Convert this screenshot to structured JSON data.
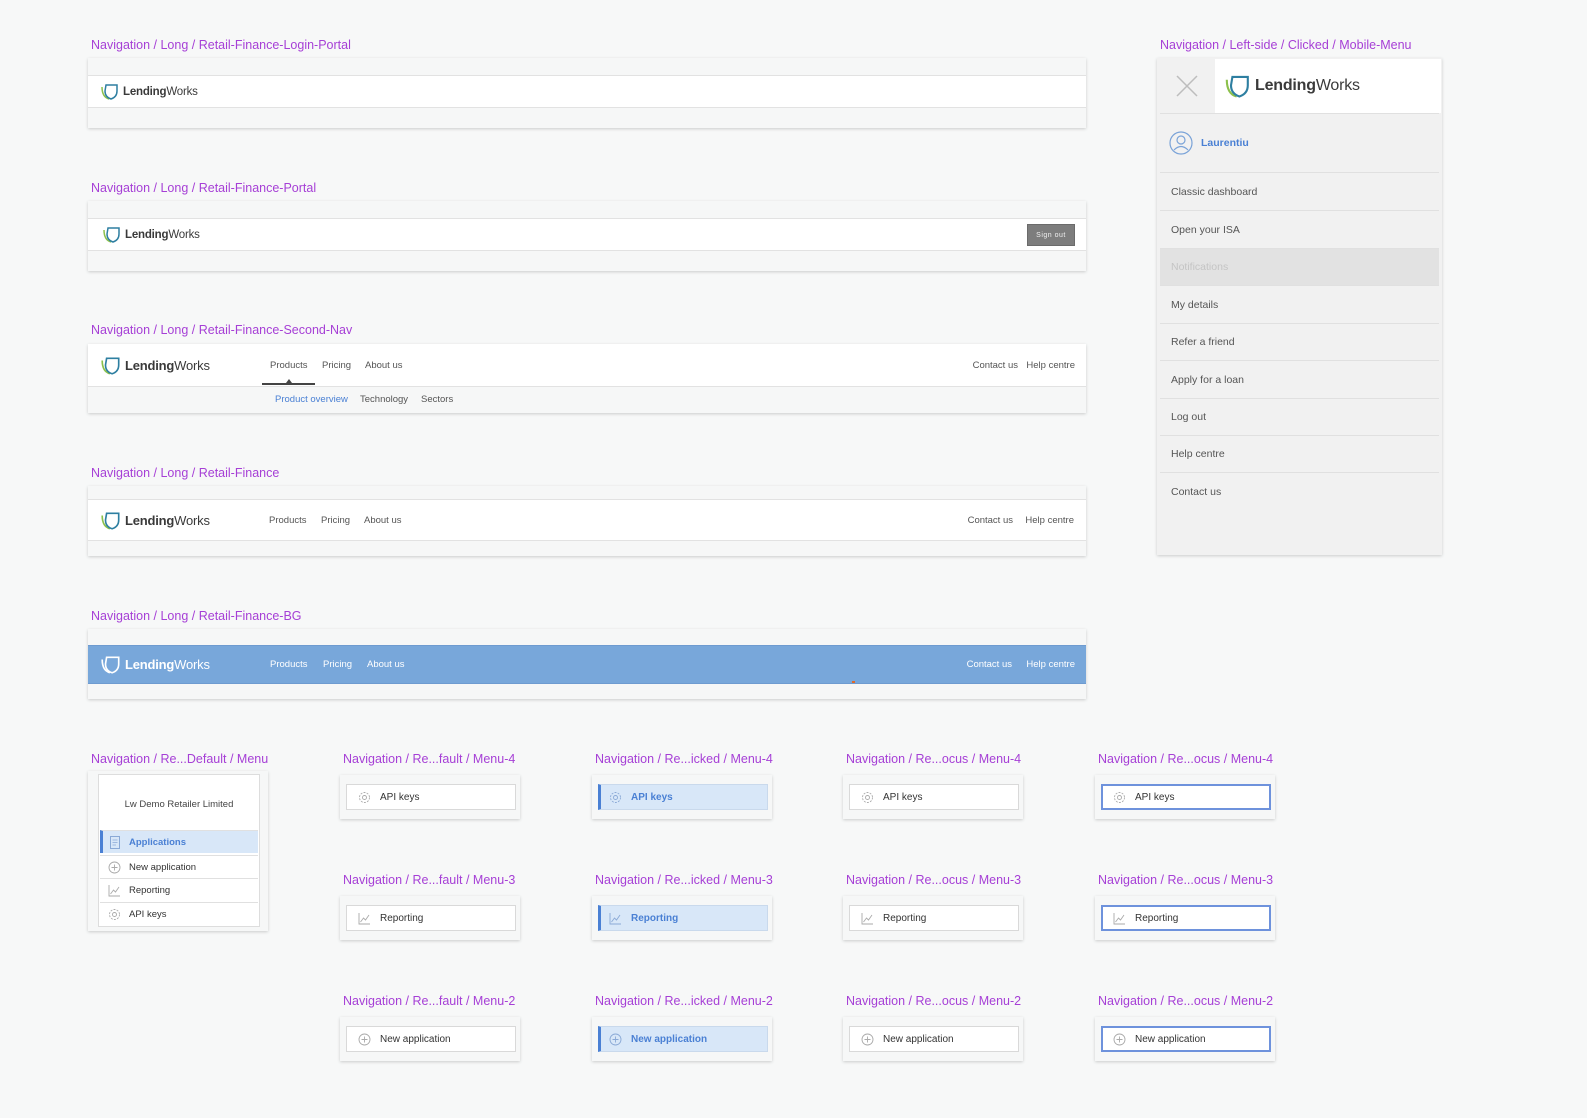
{
  "brand": {
    "logo_bold": "Lending",
    "logo_light": "Works"
  },
  "labels": {
    "login_portal": "Navigation / Long / Retail-Finance-Login-Portal",
    "portal": "Navigation / Long / Retail-Finance-Portal",
    "second_nav": "Navigation / Long / Retail-Finance-Second-Nav",
    "retail_finance": "Navigation / Long / Retail-Finance",
    "retail_finance_bg": "Navigation / Long / Retail-Finance-BG",
    "mobile_menu": "Navigation / Left-side / Clicked / Mobile-Menu",
    "default_menu": "Navigation / Re...Default / Menu",
    "default_menu4": "Navigation / Re...fault / Menu-4",
    "clicked_menu4": "Navigation / Re...icked / Menu-4",
    "focus_menu4_a": "Navigation / Re...ocus / Menu-4",
    "focus_menu4_b": "Navigation / Re...ocus / Menu-4",
    "default_menu3": "Navigation / Re...fault / Menu-3",
    "clicked_menu3": "Navigation / Re...icked / Menu-3",
    "focus_menu3_a": "Navigation / Re...ocus / Menu-3",
    "focus_menu3_b": "Navigation / Re...ocus / Menu-3",
    "default_menu2": "Navigation / Re...fault / Menu-2",
    "clicked_menu2": "Navigation / Re...icked / Menu-2",
    "focus_menu2_a": "Navigation / Re...ocus / Menu-2",
    "focus_menu2_b": "Navigation / Re...ocus / Menu-2"
  },
  "portal": {
    "sign_out": "Sign out"
  },
  "nav": {
    "products": "Products",
    "pricing": "Pricing",
    "about": "About us",
    "contact": "Contact us",
    "help": "Help centre"
  },
  "sub_nav": {
    "overview": "Product overview",
    "technology": "Technology",
    "sectors": "Sectors"
  },
  "mobile_menu": {
    "user": "Laurentiu",
    "items": [
      "Classic dashboard",
      "Open your ISA",
      "Notifications",
      "My details",
      "Refer a friend",
      "Apply for a loan",
      "Log out",
      "Help centre",
      "Contact us"
    ]
  },
  "retailer_menu": {
    "company": "Lw Demo Retailer Limited",
    "items": [
      "Applications",
      "New application",
      "Reporting",
      "API keys"
    ]
  },
  "buttons": {
    "api_keys": "API keys",
    "reporting": "Reporting",
    "new_application": "New application"
  },
  "colors": {
    "label": "#a63fd6",
    "accent": "#4a80d4",
    "bg_nav": "#78a7da",
    "active_bg": "#d8e7f8"
  }
}
